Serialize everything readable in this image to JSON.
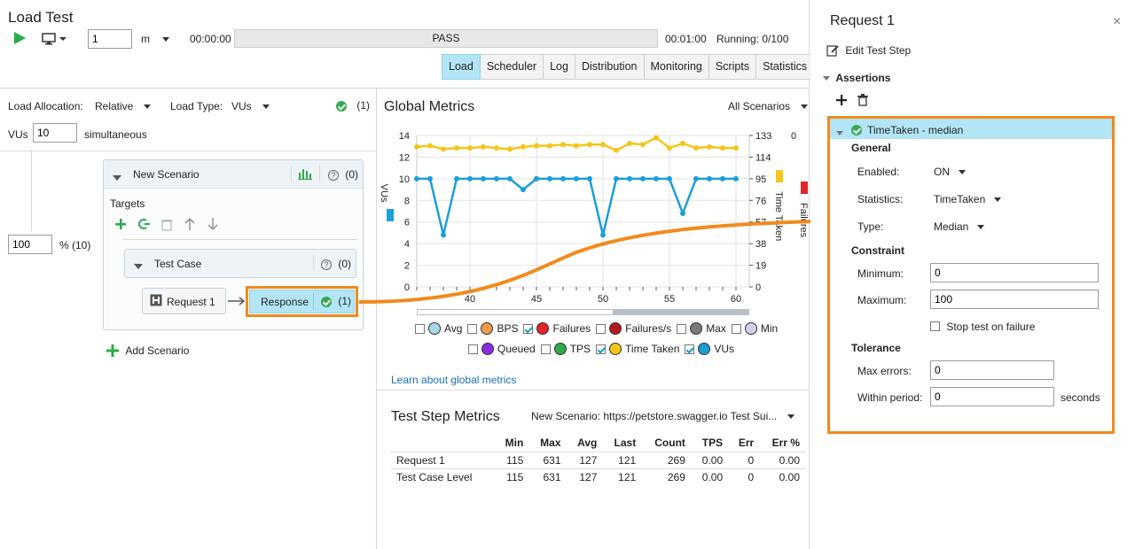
{
  "header": {
    "title": "Load Test",
    "duration_value": "1",
    "duration_unit": "m",
    "elapsed": "00:00:00",
    "status": "PASS",
    "total": "00:01:00",
    "running": "Running: 0/100"
  },
  "tabs": [
    "Load",
    "Scheduler",
    "Log",
    "Distribution",
    "Monitoring",
    "Scripts",
    "Statistics"
  ],
  "load": {
    "allocation_label": "Load Allocation:",
    "allocation_value": "Relative",
    "type_label": "Load Type:",
    "type_value": "VUs",
    "assert_count": "(1)",
    "vus_label": "VUs",
    "vus_value": "10",
    "vus_suffix": "simultaneous",
    "percent_value": "100",
    "percent_suffix": "% (10)"
  },
  "scenario": {
    "name": "New Scenario",
    "count": "(0)",
    "targets_label": "Targets",
    "test_case": "Test Case",
    "test_case_count": "(0)",
    "request": "Request 1",
    "response": "Response",
    "response_count": "(1)",
    "add_scenario": "Add Scenario"
  },
  "global_metrics": {
    "title": "Global Metrics",
    "filter": "All Scenarios",
    "link": "Learn about global metrics",
    "legend": [
      {
        "label": "Avg",
        "checked": false,
        "color": "#a7d7ea"
      },
      {
        "label": "BPS",
        "checked": false,
        "color": "#f39a4a"
      },
      {
        "label": "Failures",
        "checked": true,
        "color": "#e0262b"
      },
      {
        "label": "Failures/s",
        "checked": false,
        "color": "#b31a1e"
      },
      {
        "label": "Max",
        "checked": false,
        "color": "#7a7a7a"
      },
      {
        "label": "Min",
        "checked": false,
        "color": "#d5cdef"
      },
      {
        "label": "Queued",
        "checked": false,
        "color": "#8a2be2"
      },
      {
        "label": "TPS",
        "checked": false,
        "color": "#2eaa4a"
      },
      {
        "label": "Time Taken",
        "checked": true,
        "color": "#f5c518"
      },
      {
        "label": "VUs",
        "checked": true,
        "color": "#1a9fd9"
      }
    ]
  },
  "chart_data": {
    "type": "line",
    "xlim": [
      36,
      61
    ],
    "x_ticks": [
      "40",
      "45",
      "50",
      "55",
      "60"
    ],
    "y_left_ticks": [
      "0",
      "2",
      "4",
      "6",
      "8",
      "10",
      "12",
      "14"
    ],
    "y_left_label": "VUs",
    "y_right1_ticks": [
      "0",
      "19",
      "38",
      "57",
      "76",
      "95",
      "114",
      "133"
    ],
    "y_right1_label": "Time Taken",
    "y_right2_ticks": [
      "0"
    ],
    "y_right2_label": "Failures",
    "x": [
      36,
      37,
      38,
      39,
      40,
      41,
      42,
      43,
      44,
      45,
      46,
      47,
      48,
      49,
      50,
      51,
      52,
      53,
      54,
      55,
      56,
      57,
      58,
      59,
      60
    ],
    "series": [
      {
        "name": "VUs",
        "color": "#1a9fd9",
        "values": [
          10,
          10,
          4.8,
          10,
          10,
          10,
          10,
          10,
          9,
          10,
          10,
          10,
          10,
          10,
          4.8,
          10,
          10,
          10,
          10,
          10,
          6.8,
          10,
          10,
          10,
          10
        ]
      },
      {
        "name": "Time Taken",
        "color": "#f5c518",
        "values": [
          123,
          124,
          121,
          122,
          122,
          123,
          122,
          121,
          123,
          124,
          124,
          125,
          124,
          125,
          125,
          120,
          126,
          125,
          131,
          122,
          126,
          122,
          123,
          122,
          122
        ],
        "axis": "right"
      }
    ]
  },
  "step_metrics": {
    "title": "Test Step Metrics",
    "filter": "New Scenario: https://petstore.swagger.io Test Sui...",
    "columns": [
      "",
      "Min",
      "Max",
      "Avg",
      "Last",
      "Count",
      "TPS",
      "Err",
      "Err %"
    ],
    "rows": [
      [
        "Request 1",
        "115",
        "631",
        "127",
        "121",
        "269",
        "0.00",
        "0",
        "0.00"
      ],
      [
        "Test Case Level",
        "115",
        "631",
        "127",
        "121",
        "269",
        "0.00",
        "0",
        "0.00"
      ]
    ]
  },
  "panel": {
    "title": "Request 1",
    "edit_label": "Edit Test Step",
    "assertions_label": "Assertions",
    "assertion_name": "TimeTaken - median",
    "general_label": "General",
    "enabled_label": "Enabled:",
    "enabled_value": "ON",
    "statistics_label": "Statistics:",
    "statistics_value": "TimeTaken",
    "type_label": "Type:",
    "type_value": "Median",
    "constraint_label": "Constraint",
    "minimum_label": "Minimum:",
    "minimum_value": "0",
    "maximum_label": "Maximum:",
    "maximum_value": "100",
    "stop_label": "Stop test on failure",
    "tolerance_label": "Tolerance",
    "max_errors_label": "Max errors:",
    "max_errors_value": "0",
    "within_label": "Within period:",
    "within_value": "0",
    "seconds_label": "seconds"
  },
  "colors": {
    "accent": "#f28a1c",
    "selected": "#b3e5f7",
    "pass_bar": "#e8e8e8"
  }
}
